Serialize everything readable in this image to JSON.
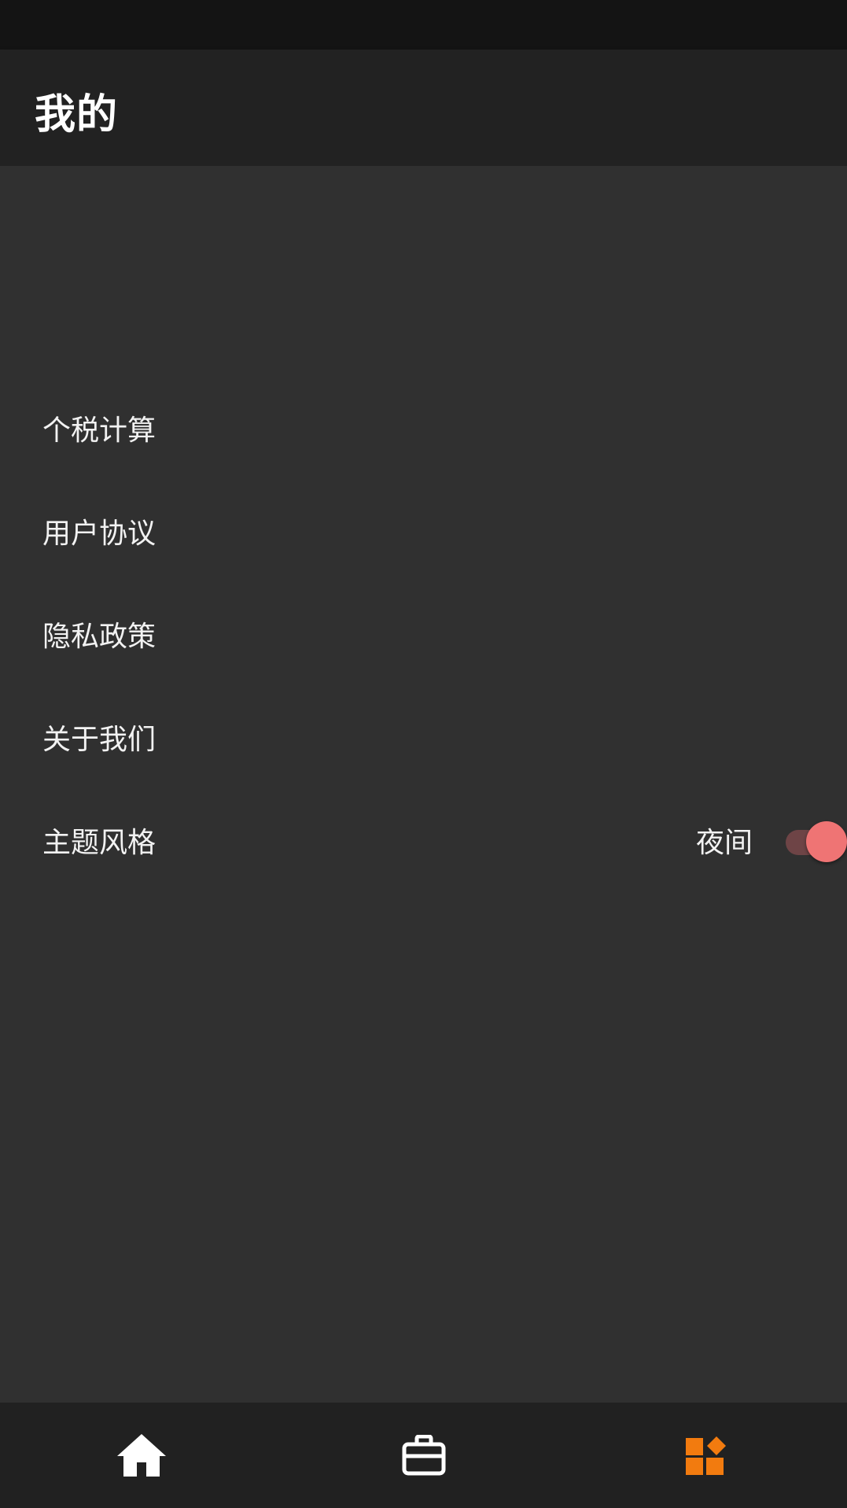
{
  "header": {
    "title": "我的"
  },
  "menu": {
    "items": [
      {
        "label": "个税计算"
      },
      {
        "label": "用户协议"
      },
      {
        "label": "隐私政策"
      },
      {
        "label": "关于我们"
      },
      {
        "label": "主题风格",
        "value": "夜间",
        "toggle_on": true
      }
    ]
  },
  "bottom_nav": {
    "items": [
      {
        "icon": "home-icon",
        "active": false
      },
      {
        "icon": "briefcase-icon",
        "active": false
      },
      {
        "icon": "widgets-icon",
        "active": true
      }
    ],
    "active_color": "#f27b0f",
    "inactive_color": "#ffffff"
  },
  "colors": {
    "background": "#303030",
    "app_bar": "#222222",
    "switch_thumb": "#ef7474",
    "switch_track": "#6e4446"
  }
}
